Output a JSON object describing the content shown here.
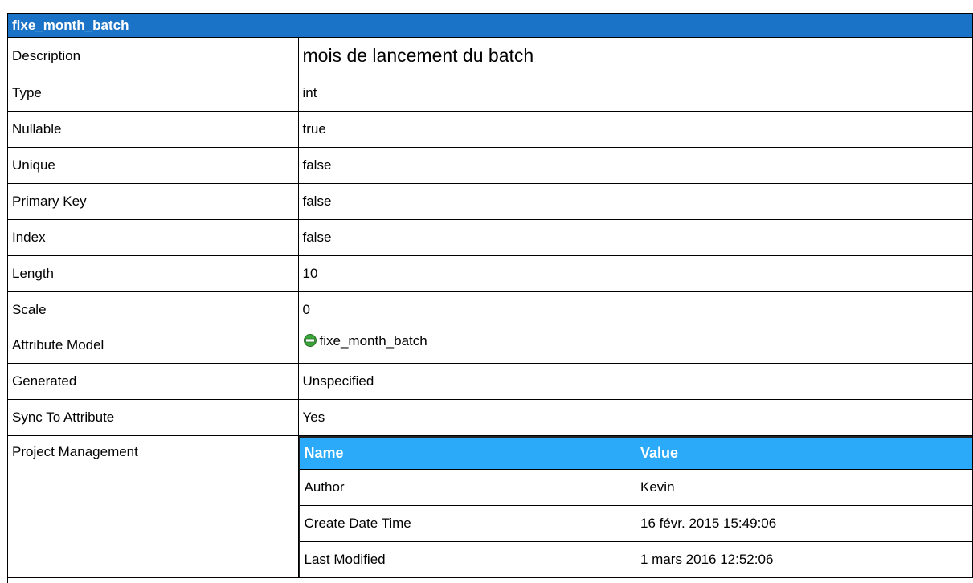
{
  "title": "fixe_month_batch",
  "rows": [
    {
      "label": "Description",
      "value": "mois de lancement du batch"
    },
    {
      "label": "Type",
      "value": "int"
    },
    {
      "label": "Nullable",
      "value": "true"
    },
    {
      "label": "Unique",
      "value": "false"
    },
    {
      "label": "Primary Key",
      "value": "false"
    },
    {
      "label": "Index",
      "value": "false"
    },
    {
      "label": "Length",
      "value": "10"
    },
    {
      "label": "Scale",
      "value": "0"
    },
    {
      "label": "Attribute Model",
      "value": "fixe_month_batch",
      "icon": "attribute-model-icon"
    },
    {
      "label": "Generated",
      "value": "Unspecified"
    },
    {
      "label": "Sync To Attribute",
      "value": "Yes"
    }
  ],
  "project_management": {
    "label": "Project Management",
    "headers": [
      "Name",
      "Value"
    ],
    "rows": [
      [
        "Author",
        "Kevin"
      ],
      [
        "Create Date Time",
        "16 févr. 2015 15:49:06"
      ],
      [
        "Last Modified",
        "1 mars 2016 12:52:06"
      ]
    ]
  },
  "colors": {
    "title_bar": "#1a73c7",
    "pm_header": "#2aaaf9",
    "icon_fill": "#3aa63a"
  }
}
